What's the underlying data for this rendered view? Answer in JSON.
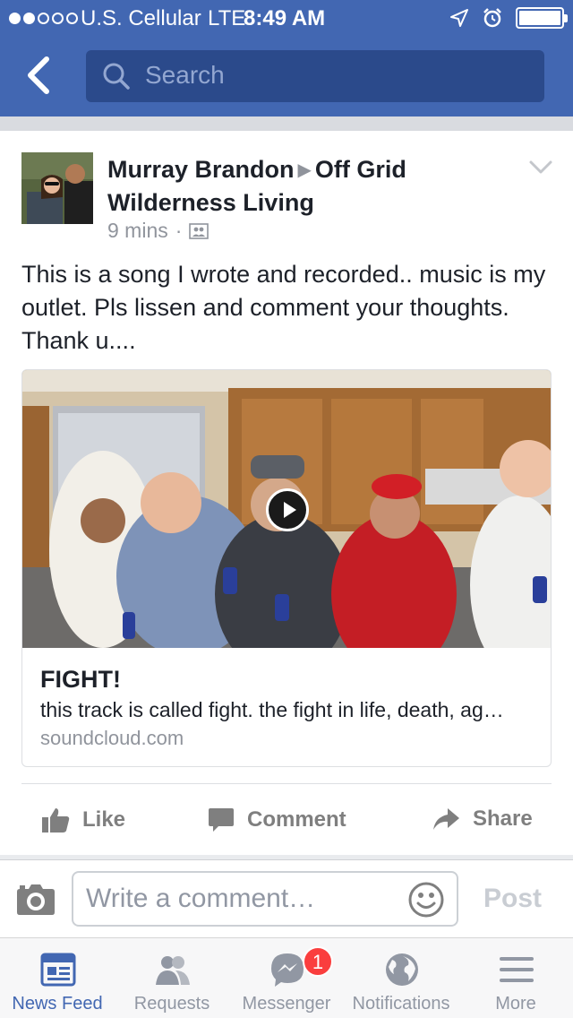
{
  "status_bar": {
    "carrier": "U.S. Cellular",
    "network": "LTE",
    "time": "8:49 AM"
  },
  "nav": {
    "search_placeholder": "Search"
  },
  "post": {
    "author": "Murray Brandon",
    "target": "Off Grid Wilderness Living",
    "time": "9 mins",
    "privacy_icon": "group-icon",
    "text": "This is a song I wrote and recorded.. music is my outlet. Pls lissen and comment your thoughts. Thank u....",
    "link_card": {
      "title": "FIGHT!",
      "description": "this track is called fight. the fight in life, death, ag…",
      "domain": "soundcloud.com"
    },
    "actions": {
      "like": "Like",
      "comment": "Comment",
      "share": "Share"
    }
  },
  "composer": {
    "placeholder": "Write a comment…",
    "post_label": "Post"
  },
  "tabs": [
    {
      "label": "News Feed",
      "icon": "news-feed-icon",
      "active": true
    },
    {
      "label": "Requests",
      "icon": "friend-requests-icon",
      "active": false
    },
    {
      "label": "Messenger",
      "icon": "messenger-icon",
      "active": false,
      "badge": "1"
    },
    {
      "label": "Notifications",
      "icon": "globe-icon",
      "active": false
    },
    {
      "label": "More",
      "icon": "menu-icon",
      "active": false
    }
  ],
  "colors": {
    "brand": "#4267b2",
    "search_bg": "#2b4a8b",
    "badge": "#fa3e3e",
    "muted": "#90949c"
  }
}
